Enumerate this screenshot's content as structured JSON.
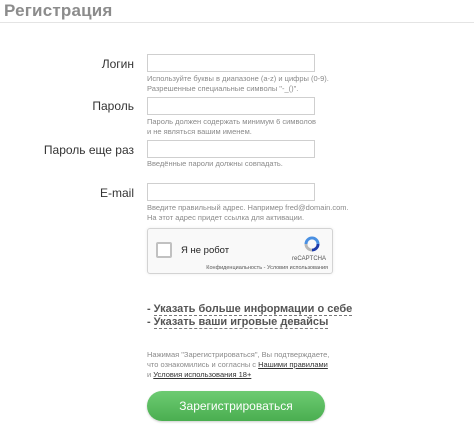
{
  "page": {
    "title": "Регистрация"
  },
  "form": {
    "login": {
      "label": "Логин",
      "value": "",
      "hint_line1": "Используйте буквы в диапазоне (a-z) и цифры (0-9).",
      "hint_line2": "Разрешенные специальные символы \"-_()\"."
    },
    "password": {
      "label": "Пароль",
      "value": "",
      "hint_line1": "Пароль должен содержать минимум 6 символов",
      "hint_line2": "и не являться вашим именем."
    },
    "password_repeat": {
      "label": "Пароль еще раз",
      "value": "",
      "hint_line1": "Введённые пароли должны совпадать."
    },
    "email": {
      "label": "E-mail",
      "value": "",
      "hint_line1": "Введите правильный адрес. Например fred@domain.com.",
      "hint_line2": "На этот адрес придет ссылка для активации."
    }
  },
  "captcha": {
    "label": "Я не робот",
    "brand": "reCAPTCHA",
    "privacy": "Конфиденциальность",
    "separator": " - ",
    "terms": "Условия использования"
  },
  "more": {
    "dash": "-",
    "about_label": "Указать больше информации о себе",
    "devices_label": "Указать ваши игровые девайсы"
  },
  "terms": {
    "line1": "Нажимая \"Зарегистрироваться\", Вы подтверждаете,",
    "line2_prefix": "что ознакомились и согласны с ",
    "rules_link": "Нашими правилами",
    "line3_prefix": "и ",
    "usage_link": "Условия использования 18+"
  },
  "submit": {
    "label": "Зарегистрироваться"
  },
  "colors": {
    "accent": "#55b85b",
    "hint": "#8a8a8a",
    "recaptcha_blue": "#4a90e2"
  },
  "icons": {
    "recaptcha": "recaptcha-logo-icon"
  }
}
